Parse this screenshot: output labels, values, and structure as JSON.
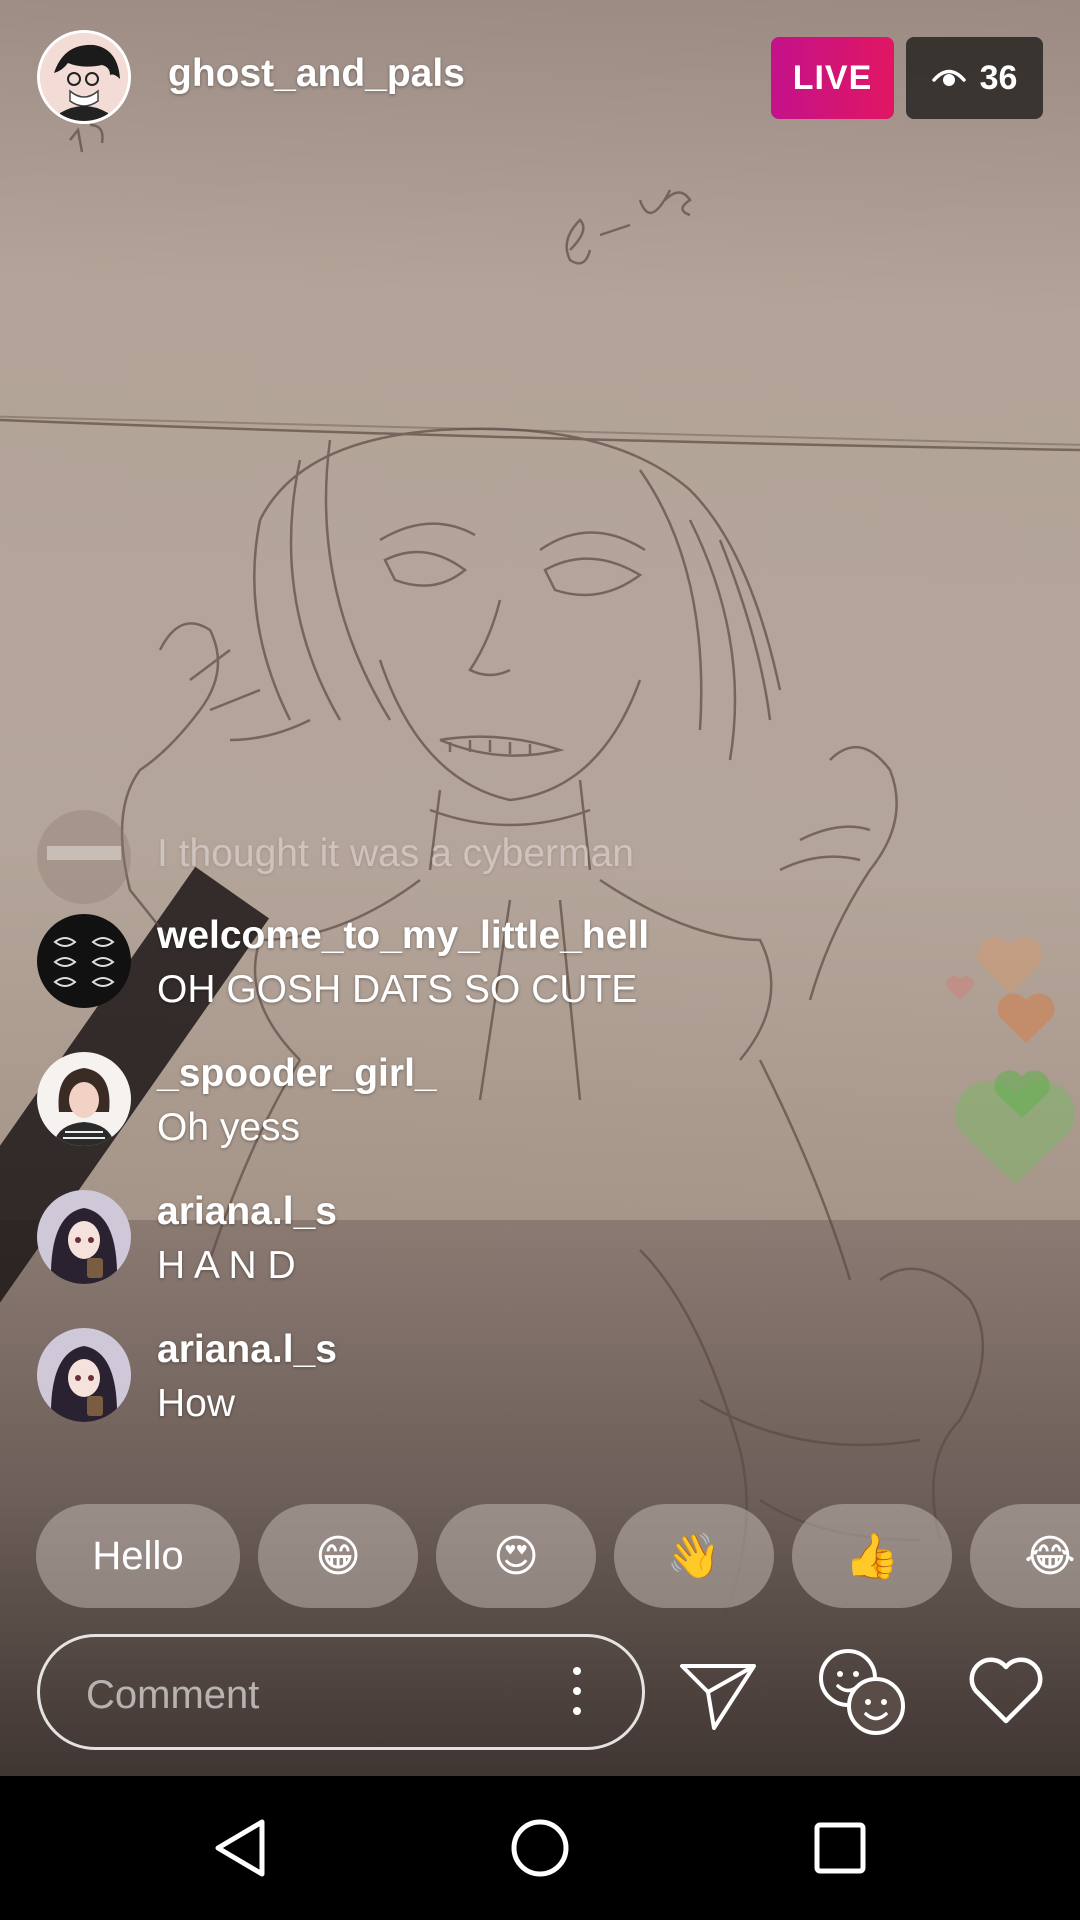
{
  "header": {
    "host_username": "ghost_and_pals",
    "live_label": "LIVE",
    "viewer_count": "36",
    "viewer_icon": "eye-icon"
  },
  "comments": [
    {
      "username": "",
      "text": "I thought it was a cyberman",
      "faded": true
    },
    {
      "username": "welcome_to_my_little_hell",
      "text": "OH GOSH DATS SO CUTE"
    },
    {
      "username": "_spooder_girl_",
      "text": "Oh yess"
    },
    {
      "username": "ariana.l_s",
      "text": "H A N D"
    },
    {
      "username": "ariana.l_s",
      "text": "How"
    }
  ],
  "quick_replies": [
    {
      "label": "Hello"
    },
    {
      "emoji": "😁"
    },
    {
      "emoji": "😍"
    },
    {
      "emoji": "👋"
    },
    {
      "emoji": "👍"
    },
    {
      "emoji": "😂"
    }
  ],
  "composer": {
    "placeholder": "Comment",
    "more_icon": "kebab-icon",
    "send_icon": "paper-plane-icon",
    "guest_icon": "two-faces-icon",
    "like_icon": "heart-icon"
  },
  "navbar": {
    "back_icon": "back-triangle-icon",
    "home_icon": "home-circle-icon",
    "recents_icon": "recents-square-icon"
  },
  "colors": {
    "live_gradient_start": "#c4128a",
    "live_gradient_end": "#e01662",
    "heart_orange": "#d99a6a",
    "heart_green": "#6fbf5a"
  }
}
